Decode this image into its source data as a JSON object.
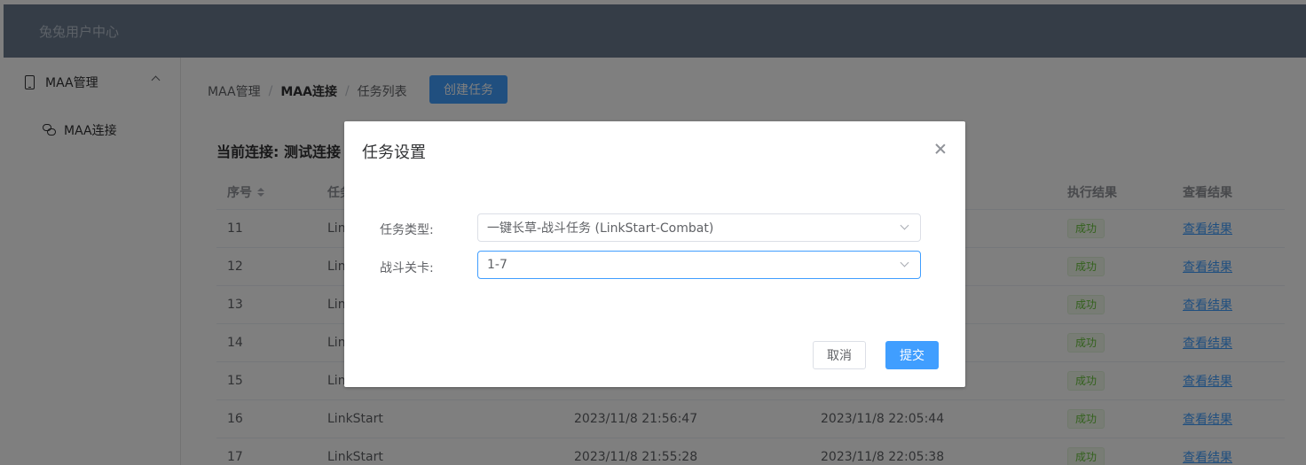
{
  "app": {
    "brand": "兔兔用户中心"
  },
  "sidebar": {
    "group_label": "MAA管理",
    "items": [
      {
        "label": "MAA连接"
      }
    ]
  },
  "breadcrumb": [
    "MAA管理",
    "MAA连接",
    "任务列表"
  ],
  "toolbar": {
    "create_label": "创建任务"
  },
  "connection_title": "当前连接: 测试连接",
  "table": {
    "headers": [
      "序号",
      "任务",
      "",
      "",
      "执行结果",
      "查看结果"
    ],
    "rows": [
      {
        "id": "11",
        "task": "LinkStart",
        "start": "",
        "end": "",
        "result": "成功",
        "link": "查看结果"
      },
      {
        "id": "12",
        "task": "LinkStart",
        "start": "",
        "end": "",
        "result": "成功",
        "link": "查看结果"
      },
      {
        "id": "13",
        "task": "LinkStart",
        "start": "",
        "end": "",
        "result": "成功",
        "link": "查看结果"
      },
      {
        "id": "14",
        "task": "LinkStart",
        "start": "",
        "end": "",
        "result": "成功",
        "link": "查看结果"
      },
      {
        "id": "15",
        "task": "LinkStart",
        "start": "",
        "end": "",
        "result": "成功",
        "link": "查看结果"
      },
      {
        "id": "16",
        "task": "LinkStart",
        "start": "2023/11/8 21:56:47",
        "end": "2023/11/8 22:05:44",
        "result": "成功",
        "link": "查看结果"
      },
      {
        "id": "17",
        "task": "LinkStart",
        "start": "2023/11/8 21:55:28",
        "end": "2023/11/8 22:05:38",
        "result": "成功",
        "link": "查看结果"
      }
    ]
  },
  "dialog": {
    "title": "任务设置",
    "task_type_label": "任务类型:",
    "task_type_value": "一键长草-战斗任务 (LinkStart-Combat)",
    "stage_label": "战斗关卡:",
    "stage_value": "1-7",
    "cancel_label": "取消",
    "submit_label": "提交"
  },
  "colors": {
    "primary": "#409eff",
    "success": "#67c23a",
    "topbar": "#6a7a8e"
  }
}
